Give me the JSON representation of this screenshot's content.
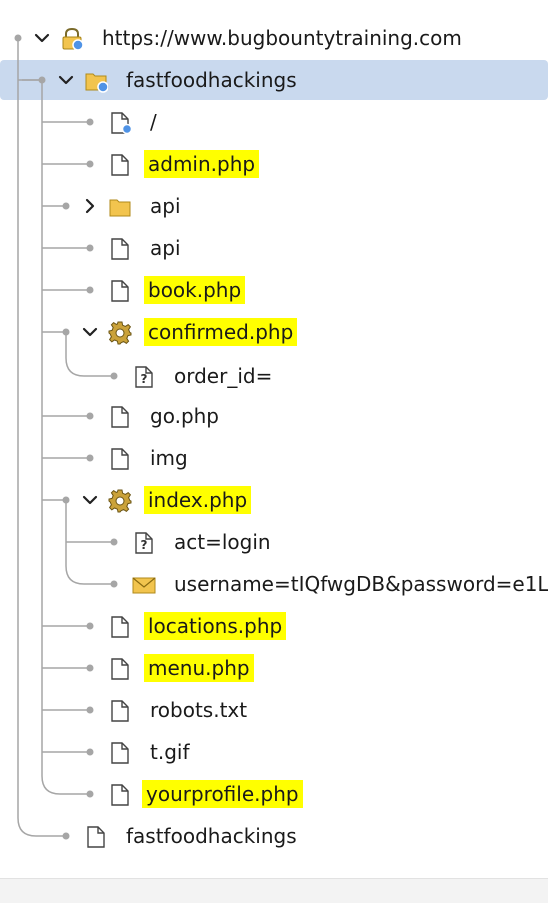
{
  "tree": {
    "root": {
      "label": "https://www.bugbountytraining.com"
    },
    "site": {
      "label": "fastfoodhackings"
    },
    "items": [
      {
        "label": "/"
      },
      {
        "label": "admin.php"
      },
      {
        "label": "api"
      },
      {
        "label": "api"
      },
      {
        "label": "book.php"
      },
      {
        "label": "confirmed.php"
      },
      {
        "label": "order_id="
      },
      {
        "label": "go.php"
      },
      {
        "label": "img"
      },
      {
        "label": "index.php"
      },
      {
        "label": "act=login"
      },
      {
        "label": "username=tIQfwgDB&password=e1L"
      },
      {
        "label": "locations.php"
      },
      {
        "label": "menu.php"
      },
      {
        "label": "robots.txt"
      },
      {
        "label": "t.gif"
      },
      {
        "label": "yourprofile.php"
      }
    ],
    "sibling": {
      "label": "fastfoodhackings"
    }
  },
  "colors": {
    "highlight": "#ffff00",
    "selection": "#c9d9ee",
    "connector": "#a6a6a6",
    "folder": "#f2c44e"
  }
}
